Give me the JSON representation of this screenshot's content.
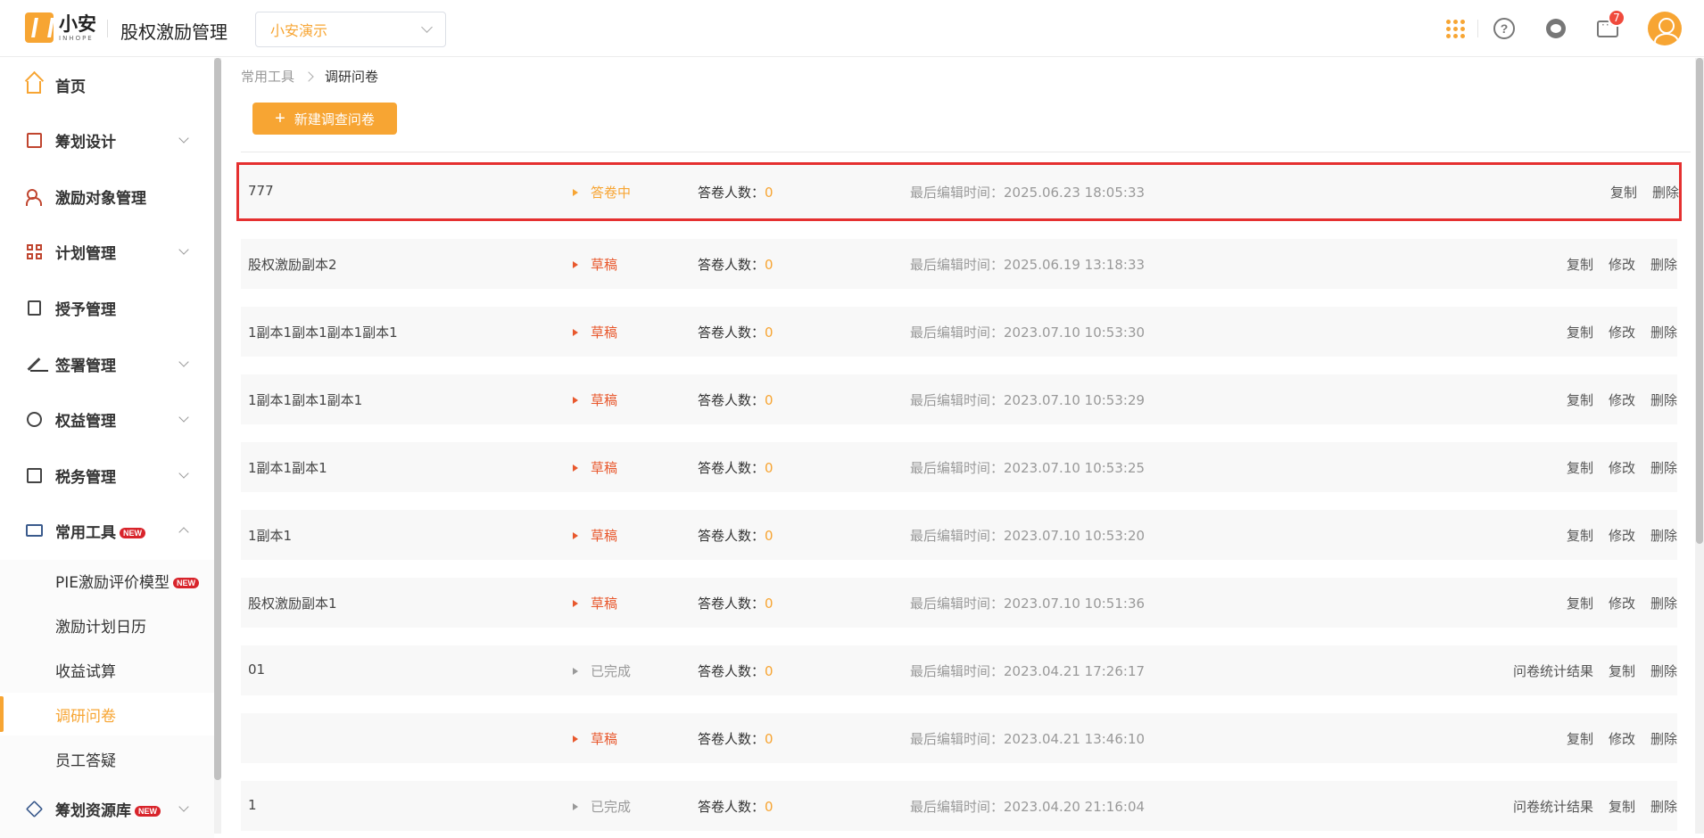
{
  "header": {
    "logo_name": "小安",
    "logo_sub": "INHOPE",
    "app_title": "股权激励管理",
    "company_select": "小安演示",
    "message_badge": "7",
    "accent_color": "#f7a533"
  },
  "sidebar": {
    "items": [
      {
        "label": "首页",
        "icon": "home-icon"
      },
      {
        "label": "筹划设计",
        "icon": "edit-icon"
      },
      {
        "label": "激励对象管理",
        "icon": "people-icon"
      },
      {
        "label": "计划管理",
        "icon": "grid-icon"
      },
      {
        "label": "授予管理",
        "icon": "book-icon"
      },
      {
        "label": "签署管理",
        "icon": "pen-icon"
      },
      {
        "label": "权益管理",
        "icon": "badge-icon"
      },
      {
        "label": "税务管理",
        "icon": "tax-icon"
      },
      {
        "label": "常用工具",
        "icon": "toolbox-icon",
        "tag": "NEW"
      },
      {
        "label": "筹划资源库",
        "icon": "layers-icon",
        "tag": "NEW"
      }
    ],
    "sub_items": [
      {
        "label": "PIE激励评价模型",
        "tag": "NEW"
      },
      {
        "label": "激励计划日历"
      },
      {
        "label": "收益试算"
      },
      {
        "label": "调研问卷"
      },
      {
        "label": "员工答疑"
      }
    ]
  },
  "breadcrumb": {
    "parent": "常用工具",
    "current": "调研问卷"
  },
  "actions": {
    "new_survey": "新建调查问卷"
  },
  "labels": {
    "respondents": "答卷人数：",
    "last_edit": "最后编辑时间：",
    "copy": "复制",
    "edit": "修改",
    "delete": "删除",
    "stats": "问卷统计结果"
  },
  "surveys": [
    {
      "name": "777",
      "status": "答卷中",
      "count": "0",
      "time": "2025.06.23 18:05:33"
    },
    {
      "name": "股权激励副本2",
      "status": "草稿",
      "count": "0",
      "time": "2025.06.19 13:18:33"
    },
    {
      "name": "1副本1副本1副本1副本1",
      "status": "草稿",
      "count": "0",
      "time": "2023.07.10 10:53:30"
    },
    {
      "name": "1副本1副本1副本1",
      "status": "草稿",
      "count": "0",
      "time": "2023.07.10 10:53:29"
    },
    {
      "name": "1副本1副本1",
      "status": "草稿",
      "count": "0",
      "time": "2023.07.10 10:53:25"
    },
    {
      "name": "1副本1",
      "status": "草稿",
      "count": "0",
      "time": "2023.07.10 10:53:20"
    },
    {
      "name": "股权激励副本1",
      "status": "草稿",
      "count": "0",
      "time": "2023.07.10 10:51:36"
    },
    {
      "name": "01",
      "status": "已完成",
      "count": "0",
      "time": "2023.04.21 17:26:17"
    },
    {
      "name": "",
      "status": "草稿",
      "count": "0",
      "time": "2023.04.21 13:46:10"
    },
    {
      "name": "1",
      "status": "已完成",
      "count": "0",
      "time": "2023.04.20 21:16:04"
    }
  ]
}
